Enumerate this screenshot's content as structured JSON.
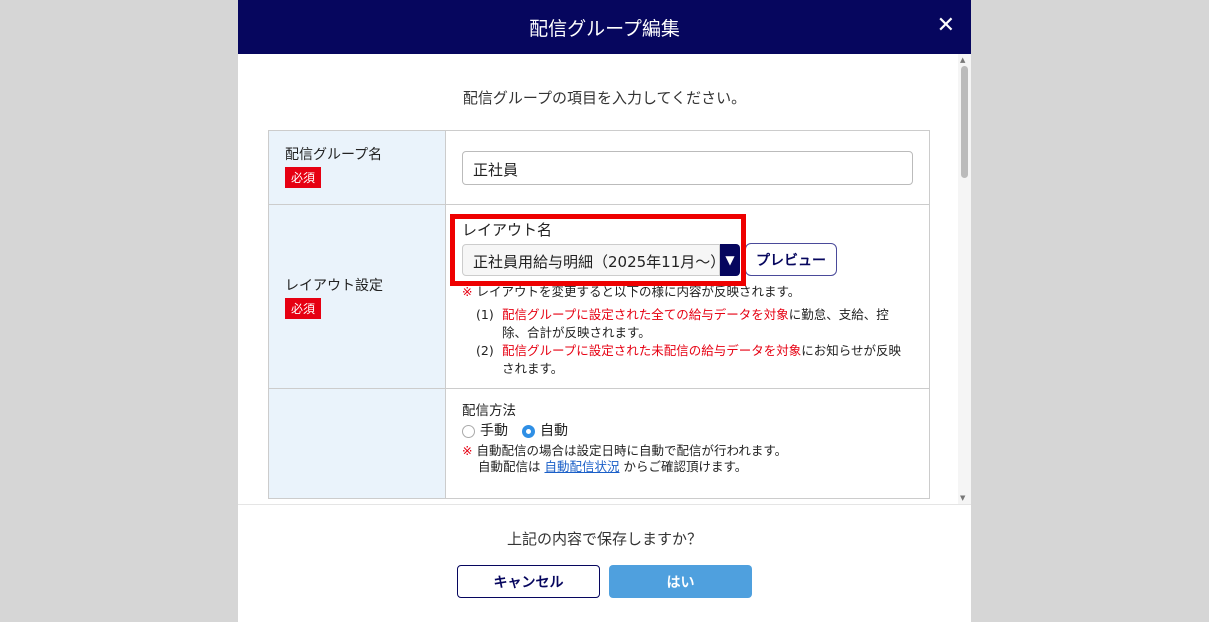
{
  "dialog": {
    "title": "配信グループ編集",
    "intro": "配信グループの項目を入力してください。"
  },
  "form": {
    "group_name": {
      "label": "配信グループ名",
      "required": "必須",
      "value": "正社員"
    },
    "layout": {
      "label": "レイアウト設定",
      "required": "必須",
      "field_label": "レイアウト名",
      "selected": "正社員用給与明細（2025年11月～）",
      "preview": "プレビュー",
      "note_mark": "※",
      "note": "レイアウトを変更すると以下の様に内容が反映されます。",
      "items": [
        {
          "num": "(1)",
          "red": "配信グループに設定された全ての給与データを対象",
          "rest": "に勤怠、支給、控除、合計が反映されます。"
        },
        {
          "num": "(2)",
          "red": "配信グループに設定された未配信の給与データを対象",
          "rest": "にお知らせが反映されます。"
        }
      ]
    },
    "method": {
      "label": "配信方法",
      "options": [
        "手動",
        "自動"
      ],
      "selected": "自動",
      "note_mark": "※",
      "note": "自動配信の場合は設定日時に自動で配信が行われます。",
      "note2_pre": "自動配信は ",
      "link": "自動配信状況",
      "note2_post": " からご確認頂けます。"
    }
  },
  "footer": {
    "question": "上記の内容で保存しますか？",
    "cancel": "キャンセル",
    "ok": "はい"
  }
}
